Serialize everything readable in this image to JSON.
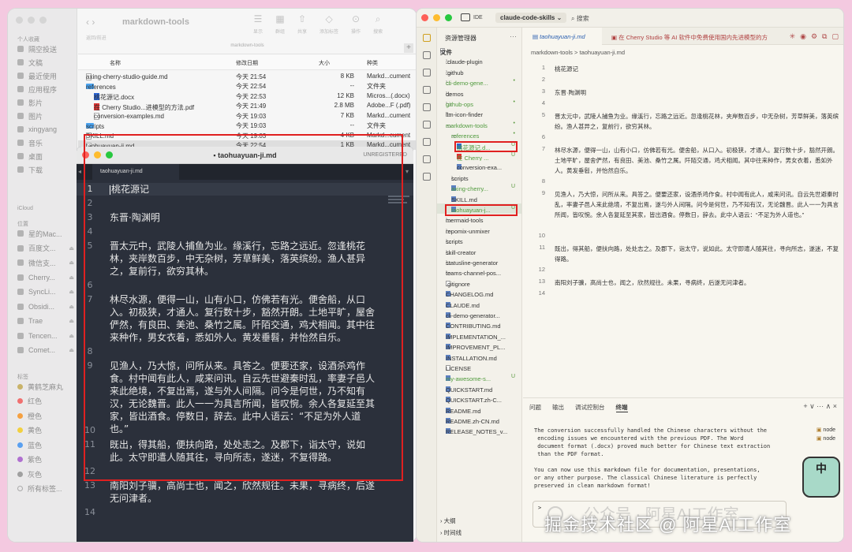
{
  "finder": {
    "sidebar": {
      "favorites_label": "个人收藏",
      "favorites": [
        {
          "label": "隔空投送",
          "icon": "airdrop-icon"
        },
        {
          "label": "文稿",
          "icon": "document-icon"
        },
        {
          "label": "最近使用",
          "icon": "clock-icon"
        },
        {
          "label": "应用程序",
          "icon": "apps-icon"
        },
        {
          "label": "影片",
          "icon": "film-icon"
        },
        {
          "label": "图片",
          "icon": "image-icon"
        },
        {
          "label": "xingyang",
          "icon": "home-icon"
        },
        {
          "label": "音乐",
          "icon": "music-icon"
        },
        {
          "label": "桌面",
          "icon": "desktop-icon"
        },
        {
          "label": "下载",
          "icon": "download-icon"
        }
      ],
      "icloud_label": "iCloud",
      "locations_label": "位置",
      "locations": [
        {
          "label": "星的Mac..."
        },
        {
          "label": "百度文..."
        },
        {
          "label": "微信支..."
        },
        {
          "label": "Cherry..."
        },
        {
          "label": "SyncLi..."
        },
        {
          "label": "Obsidi..."
        },
        {
          "label": "Trae"
        },
        {
          "label": "Tencen..."
        },
        {
          "label": "Comet..."
        }
      ],
      "tags_label": "标签",
      "tags": [
        {
          "label": "黄鹤芝麻丸",
          "color": "#c9b36a"
        },
        {
          "label": "红色",
          "color": "#f07070"
        },
        {
          "label": "橙色",
          "color": "#f5a040"
        },
        {
          "label": "黄色",
          "color": "#f2d040"
        },
        {
          "label": "蓝色",
          "color": "#5aa0f0"
        },
        {
          "label": "紫色",
          "color": "#b070d0"
        },
        {
          "label": "灰色",
          "color": "#a0a0a0"
        },
        {
          "label": "所有标签..."
        }
      ]
    },
    "toolbar": {
      "back_forward": "返回/前进",
      "title": "markdown-tools",
      "tools": [
        {
          "label": "显示",
          "glyph": "☰"
        },
        {
          "label": "群组",
          "glyph": "▦"
        },
        {
          "label": "共享",
          "glyph": "⇧"
        },
        {
          "label": "添加标签",
          "glyph": "◇"
        },
        {
          "label": "操作",
          "glyph": "⊙"
        },
        {
          "label": "搜索",
          "glyph": "⌕"
        }
      ],
      "path": "markdown-tools"
    },
    "columns": {
      "name": "名称",
      "date": "修改日期",
      "size": "大小",
      "kind": "种类"
    },
    "rows": [
      {
        "name": "axing-cherry-studio-guide.md",
        "date": "今天 21:54",
        "size": "8 KB",
        "kind": "Markd...cument",
        "icon": "file",
        "indent": 0
      },
      {
        "name": "references",
        "date": "今天 22:54",
        "size": "--",
        "kind": "文件夹",
        "icon": "folder",
        "indent": 0,
        "chev": "v"
      },
      {
        "name": "桃花源记.docx",
        "date": "今天 22:53",
        "size": "12 KB",
        "kind": "Micros...(.docx)",
        "icon": "docx",
        "indent": 1
      },
      {
        "name": "在 Cherry Studio...进模型的方法.pdf",
        "date": "今天 21:49",
        "size": "2.8 MB",
        "kind": "Adobe...F (.pdf)",
        "icon": "pdf",
        "indent": 1
      },
      {
        "name": "conversion-examples.md",
        "date": "今天 19:03",
        "size": "7 KB",
        "kind": "Markd...cument",
        "icon": "file",
        "indent": 1
      },
      {
        "name": "scripts",
        "date": "今天 19:03",
        "size": "--",
        "kind": "文件夹",
        "icon": "folder",
        "indent": 0,
        "chev": ">"
      },
      {
        "name": "SKILL.md",
        "date": "今天 19:03",
        "size": "4 KB",
        "kind": "Markd...cument",
        "icon": "file",
        "indent": 0
      },
      {
        "name": "taohuayuan-ji.md",
        "date": "今天 22:54",
        "size": "1 KB",
        "kind": "Markd...cument",
        "icon": "file",
        "indent": 0,
        "selected": true
      }
    ]
  },
  "sublime": {
    "title": "taohuayuan-ji.md",
    "unregistered": "UNREGISTERED",
    "tab": "taohuayuan-ji.md",
    "lines": [
      {
        "n": "1",
        "text": "桃花源记",
        "rows": 1
      },
      {
        "n": "2",
        "text": "",
        "rows": 1
      },
      {
        "n": "3",
        "text": "东晋·陶渊明",
        "rows": 1
      },
      {
        "n": "4",
        "text": "",
        "rows": 1
      },
      {
        "n": "5",
        "text": "晋太元中，武陵人捕鱼为业。缘溪行，忘路之远近。忽逢桃花林，夹岸数百步，中无杂树，芳草鲜美，落英缤纷。渔人甚异之，复前行，欲穷其林。",
        "rows": 3
      },
      {
        "n": "6",
        "text": "",
        "rows": 1
      },
      {
        "n": "7",
        "text": "林尽水源，便得一山，山有小口，仿佛若有光。便舍船，从口入。初极狭，才通人。复行数十步，豁然开朗。土地平旷，屋舍俨然，有良田、美池、桑竹之属。阡陌交通，鸡犬相闻。其中往来种作，男女衣着，悉如外人。黄发垂髫，并怡然自乐。",
        "rows": 4
      },
      {
        "n": "8",
        "text": "",
        "rows": 1
      },
      {
        "n": "9",
        "text": "见渔人，乃大惊，问所从来。具答之。便要还家，设酒杀鸡作食。村中闻有此人，咸来问讯。自云先世避秦时乱，率妻子邑人来此绝境，不复出焉，遂与外人间隔。问今是何世，乃不知有汉，无论魏晋。此人一一为具言所闻，皆叹惋。余人各复延至其家，皆出酒食。停数日，辞去。此中人语云：“不足为外人道也。”",
        "rows": 5
      },
      {
        "n": "10",
        "text": "",
        "rows": 1
      },
      {
        "n": "11",
        "text": "既出，得其船，便扶向路，处处志之。及郡下，诣太守，说如此。太守即遣人随其往，寻向所志，遂迷，不复得路。",
        "rows": 2
      },
      {
        "n": "12",
        "text": "",
        "rows": 1
      },
      {
        "n": "13",
        "text": "南阳刘子骥，高尚士也，闻之，欣然规往。未果，寻病终，后遂无问津者。",
        "rows": 2
      },
      {
        "n": "14",
        "text": "",
        "rows": 1
      }
    ]
  },
  "vscode": {
    "ide_label": "IDE",
    "project": "claude-code-skills",
    "search": "搜索",
    "explorer_title": "资源管理器",
    "tree": [
      {
        "label": "文件",
        "indent": 0,
        "chev": "v",
        "bold": true
      },
      {
        "label": ".claude-plugin",
        "indent": 1,
        "chev": ">",
        "icon": "folder"
      },
      {
        "label": ".github",
        "indent": 1,
        "chev": ">",
        "icon": "folder"
      },
      {
        "label": "cli-demo-gene...",
        "indent": 1,
        "chev": ">",
        "icon": "folder",
        "green": true,
        "dot": "•"
      },
      {
        "label": "demos",
        "indent": 1,
        "chev": ">",
        "icon": "folder"
      },
      {
        "label": "github-ops",
        "indent": 1,
        "chev": ">",
        "icon": "folder",
        "green": true,
        "dot": "•"
      },
      {
        "label": "llm-icon-finder",
        "indent": 1,
        "chev": ">",
        "icon": "folder"
      },
      {
        "label": "markdown-tools",
        "indent": 1,
        "chev": "v",
        "icon": "folder",
        "green": true,
        "dot": "•"
      },
      {
        "label": "references",
        "indent": 2,
        "chev": "v",
        "icon": "folder",
        "green": true,
        "dot": "•"
      },
      {
        "label": "桃花源记.d...",
        "indent": 3,
        "icon": "docx",
        "green": true,
        "badge": "U"
      },
      {
        "label": "在 Cherry ...",
        "indent": 3,
        "icon": "pdf",
        "green": true,
        "badge": "U"
      },
      {
        "label": "conversion-exa...",
        "indent": 3,
        "icon": "md"
      },
      {
        "label": "scripts",
        "indent": 2,
        "chev": ">",
        "icon": "folder"
      },
      {
        "label": "axing-cherry...",
        "indent": 2,
        "icon": "md",
        "green": true,
        "badge": "U"
      },
      {
        "label": "SKILL.md",
        "indent": 2,
        "icon": "md"
      },
      {
        "label": "taohuayuan-j...",
        "indent": 2,
        "icon": "md",
        "green": true,
        "badge": "U",
        "selected": true
      },
      {
        "label": "mermaid-tools",
        "indent": 1,
        "chev": ">",
        "icon": "folder"
      },
      {
        "label": "repomix-unmixer",
        "indent": 1,
        "chev": ">",
        "icon": "folder"
      },
      {
        "label": "scripts",
        "indent": 1,
        "chev": ">",
        "icon": "folder"
      },
      {
        "label": "skill-creator",
        "indent": 1,
        "chev": ">",
        "icon": "folder"
      },
      {
        "label": "statusline-generator",
        "indent": 1,
        "chev": ">",
        "icon": "folder"
      },
      {
        "label": "teams-channel-pos...",
        "indent": 1,
        "chev": ">",
        "icon": "folder"
      },
      {
        "label": ".gitignore",
        "indent": 1,
        "icon": "file"
      },
      {
        "label": "CHANGELOG.md",
        "indent": 1,
        "icon": "md"
      },
      {
        "label": "CLAUDE.md",
        "indent": 1,
        "icon": "md"
      },
      {
        "label": "cli-demo-generator...",
        "indent": 1,
        "icon": "md"
      },
      {
        "label": "CONTRIBUTING.md",
        "indent": 1,
        "icon": "md"
      },
      {
        "label": "IMPLEMENTATION_...",
        "indent": 1,
        "icon": "md"
      },
      {
        "label": "IMPROVEMENT_PL...",
        "indent": 1,
        "icon": "md"
      },
      {
        "label": "INSTALLATION.md",
        "indent": 1,
        "icon": "md"
      },
      {
        "label": "LICENSE",
        "indent": 1,
        "icon": "file"
      },
      {
        "label": "my-awesome-s...",
        "indent": 1,
        "icon": "md",
        "green": true,
        "badge": "U"
      },
      {
        "label": "QUICKSTART.md",
        "indent": 1,
        "icon": "md"
      },
      {
        "label": "QUICKSTART.zh-C...",
        "indent": 1,
        "icon": "md"
      },
      {
        "label": "README.md",
        "indent": 1,
        "icon": "md"
      },
      {
        "label": "README.zh-CN.md",
        "indent": 1,
        "icon": "md"
      },
      {
        "label": "RELEASE_NOTES_v...",
        "indent": 1,
        "icon": "md"
      }
    ],
    "outline": "大纲",
    "timeline": "时间线",
    "tab_active": "taohuayuan-ji.md",
    "tab_second": "在 Cherry Studio 等 AI 软件中免费使用国内先进模型的方",
    "breadcrumb": "markdown-tools  >  taohuayuan-ji.md",
    "editor_lines": [
      {
        "n": "1",
        "text": "桃花源记",
        "rows": 1
      },
      {
        "n": "2",
        "text": "",
        "rows": 1
      },
      {
        "n": "3",
        "text": "东晋·陶渊明",
        "rows": 1
      },
      {
        "n": "4",
        "text": "",
        "rows": 1
      },
      {
        "n": "5",
        "text": "晋太元中，武陵人捕鱼为业。缘溪行，忘路之远近。忽逢桃花林，夹岸数百步，中无杂树，芳草鲜美，落英缤纷。渔人甚异之，复前行，欲穷其林。",
        "rows": 2
      },
      {
        "n": "6",
        "text": "",
        "rows": 1
      },
      {
        "n": "7",
        "text": "林尽水源，便得一山，山有小口，仿佛若有光。便舍船，从口入。初极狭，才通人。复行数十步，豁然开朗。土地平旷，屋舍俨然，有良田、美池、桑竹之属。阡陌交通，鸡犬相闻。其中往来种作，男女衣着，悉如外人。黄发垂髫，并怡然自乐。",
        "rows": 3
      },
      {
        "n": "8",
        "text": "",
        "rows": 1
      },
      {
        "n": "9",
        "text": "见渔人，乃大惊，问所从来。具答之。便要还家，设酒杀鸡作食。村中闻有此人，咸来问讯。自云先世避秦时乱，率妻子邑人来此绝境，不复出焉，遂与外人间隔。问今是何世，乃不知有汉，无论魏晋。此人一一为具言所闻，皆叹惋。余人各复延至其家，皆出酒食。停数日，辞去。此中人语云：“不足为外人道也。”",
        "rows": 4
      },
      {
        "n": "10",
        "text": "",
        "rows": 1
      },
      {
        "n": "11",
        "text": "既出，得其船，便扶向路，处处志之。及郡下，诣太守，说如此。太守即遣人随其往，寻向所志，遂迷，不复得路。",
        "rows": 2
      },
      {
        "n": "12",
        "text": "",
        "rows": 1
      },
      {
        "n": "13",
        "text": "南阳刘子骥，高尚士也，闻之，欣然规往。未果，寻病终，后遂无问津者。",
        "rows": 1
      },
      {
        "n": "14",
        "text": "",
        "rows": 1
      }
    ],
    "panel_tabs": [
      "问题",
      "输出",
      "调试控制台",
      "终端"
    ],
    "panel_tools": "+ ∨  ···  ∧  ×",
    "terminal_text": "The conversion successfully handled the Chinese characters without the\n encoding issues we encountered with the previous PDF. The Word\n document format (.docx) proved much better for Chinese text extraction\n than the PDF format.\n\nYou can now use this markdown file for documentation, presentations,\nor any other purpose. The classical Chinese literature is perfectly\npreserved in clean markdown format!",
    "terminal_prompt": ">",
    "node_sessions": [
      "node",
      "node"
    ],
    "mascot": "中"
  },
  "watermark": {
    "text": "掘金技术社区 @ 阿星AI工作室",
    "ghost": "公众号 · 阿星AI工作室"
  }
}
